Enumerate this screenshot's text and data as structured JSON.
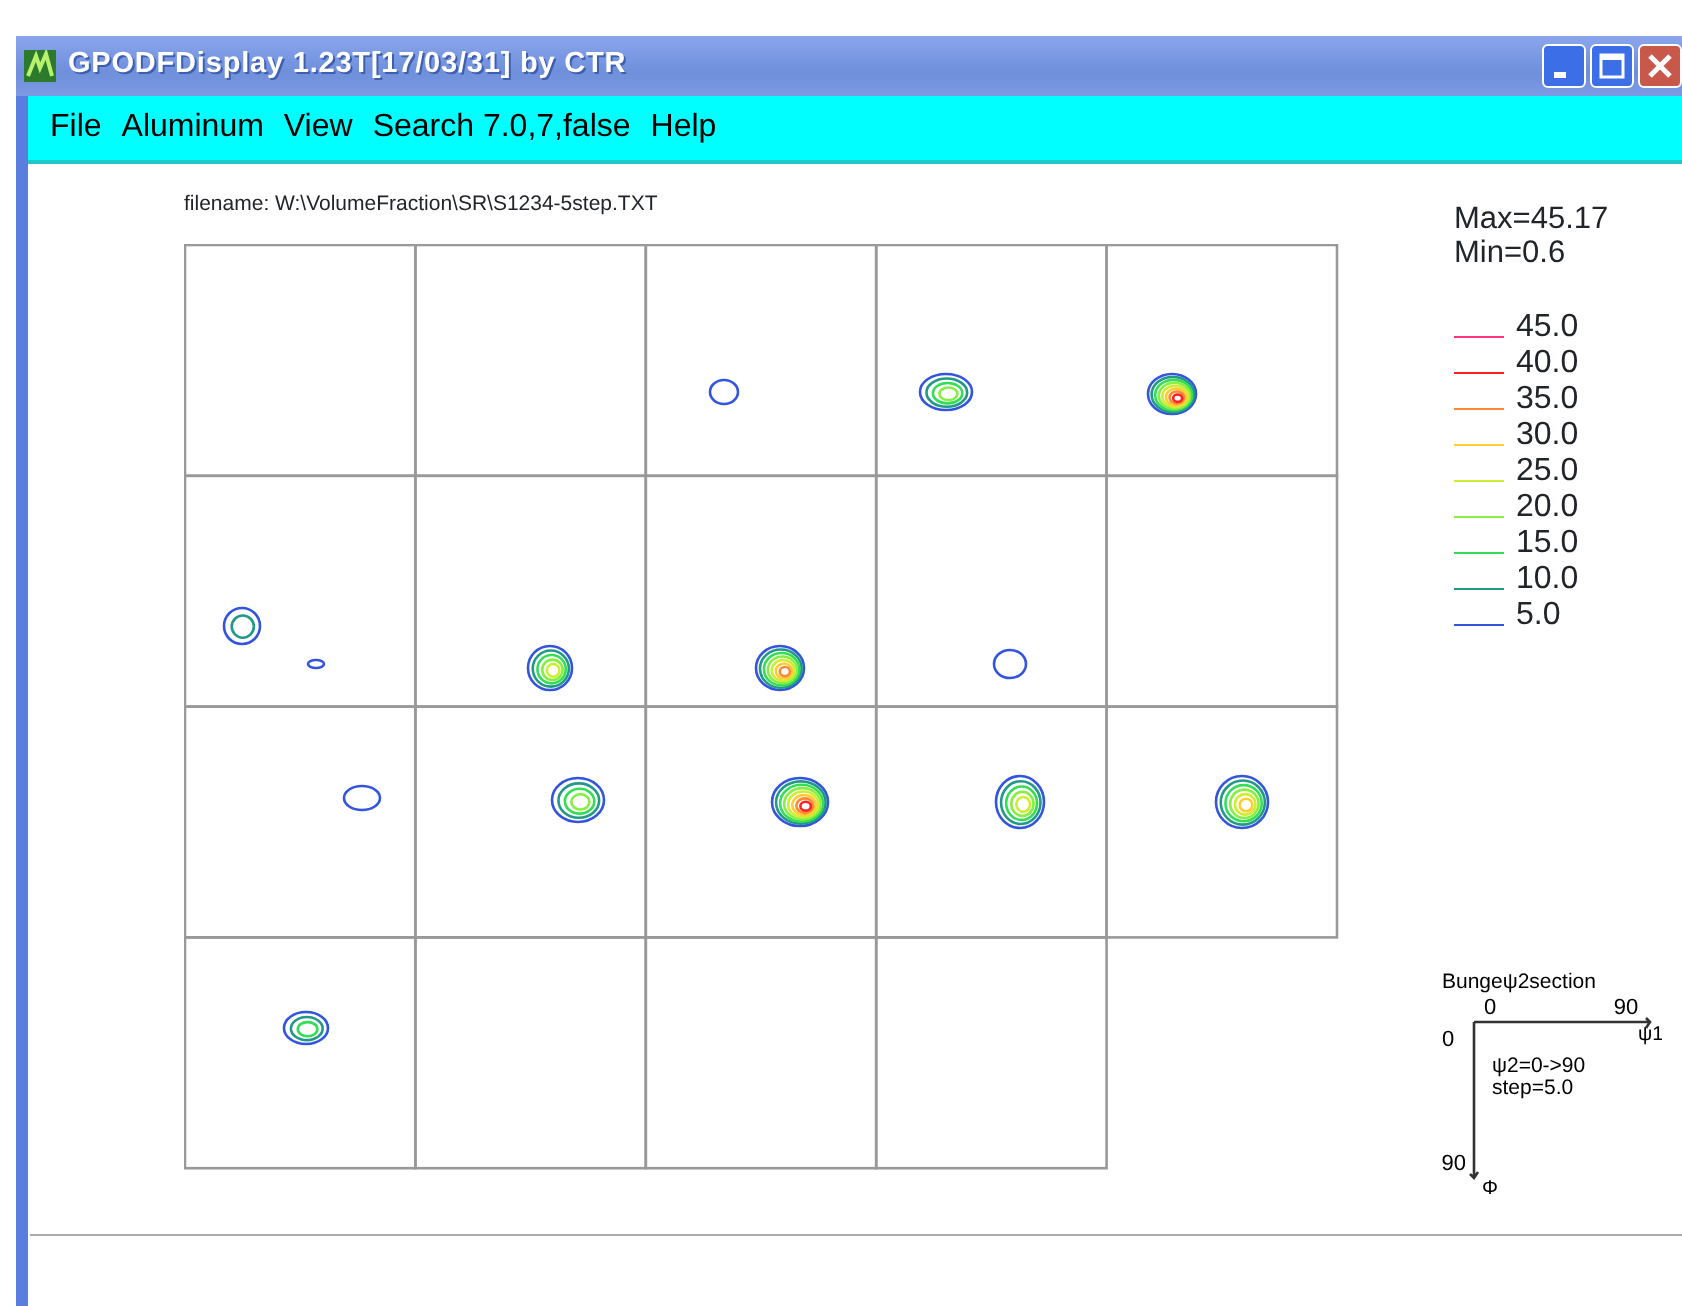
{
  "window": {
    "title": "GPODFDisplay 1.23T[17/03/31] by CTR"
  },
  "menu": [
    "File",
    "Aluminum",
    "View",
    "Search 7.0,7,false",
    "Help"
  ],
  "filename": "filename: W:\\VolumeFraction\\SR\\S1234-5step.TXT",
  "stats": {
    "max": "Max=45.17",
    "min": "Min=0.6"
  },
  "legend": [
    {
      "label": "45.0",
      "color": "#ff3377"
    },
    {
      "label": "40.0",
      "color": "#ff2020"
    },
    {
      "label": "35.0",
      "color": "#ff8833"
    },
    {
      "label": "30.0",
      "color": "#ffcc33"
    },
    {
      "label": "25.0",
      "color": "#ccee33"
    },
    {
      "label": "20.0",
      "color": "#88ee44"
    },
    {
      "label": "15.0",
      "color": "#33dd55"
    },
    {
      "label": "10.0",
      "color": "#229988"
    },
    {
      "label": "5.0",
      "color": "#3355dd"
    }
  ],
  "axes": {
    "title": "Bungeψ2section",
    "x_start": "0",
    "x_end": "90",
    "x_label": "ψ1",
    "y_start": "0",
    "y_end": "90",
    "y_label": "Φ",
    "notes": [
      "ψ2=0->90",
      "step=5.0"
    ]
  }
}
